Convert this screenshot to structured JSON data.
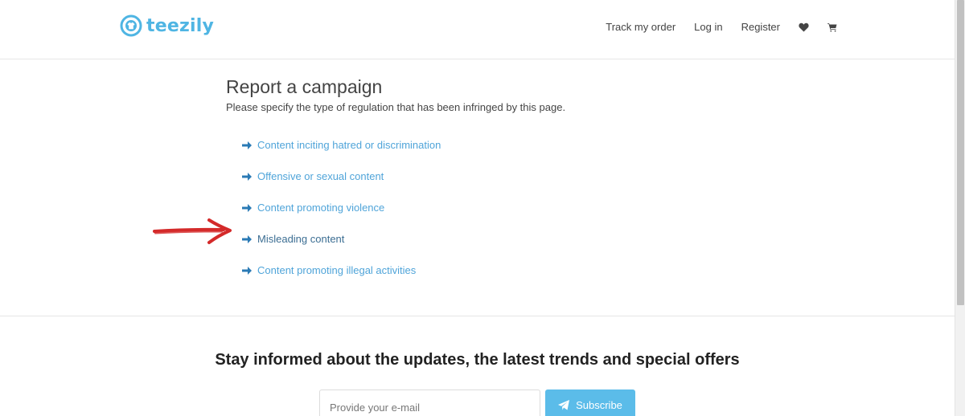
{
  "header": {
    "logo_text": "teezily",
    "nav": {
      "track_order": "Track my order",
      "login": "Log in",
      "register": "Register"
    },
    "icons": [
      "heart-icon",
      "cart-icon"
    ]
  },
  "main": {
    "title": "Report a campaign",
    "subtitle": "Please specify the type of regulation that has been infringed by this page.",
    "reasons": [
      {
        "label": "Content inciting hatred or discrimination"
      },
      {
        "label": "Offensive or sexual content"
      },
      {
        "label": "Content promoting violence"
      },
      {
        "label": "Misleading content",
        "hovered": true
      },
      {
        "label": "Content promoting illegal activities"
      }
    ]
  },
  "newsletter": {
    "title": "Stay informed about the updates, the latest trends and special offers",
    "email_placeholder": "Provide your e-mail",
    "subscribe_label": "Subscribe"
  },
  "colors": {
    "brand": "#4fb5e3",
    "link": "#4fa4d9",
    "link_hover": "#3c6e93",
    "button": "#5bbce9",
    "annotation": "#d42a2a"
  }
}
